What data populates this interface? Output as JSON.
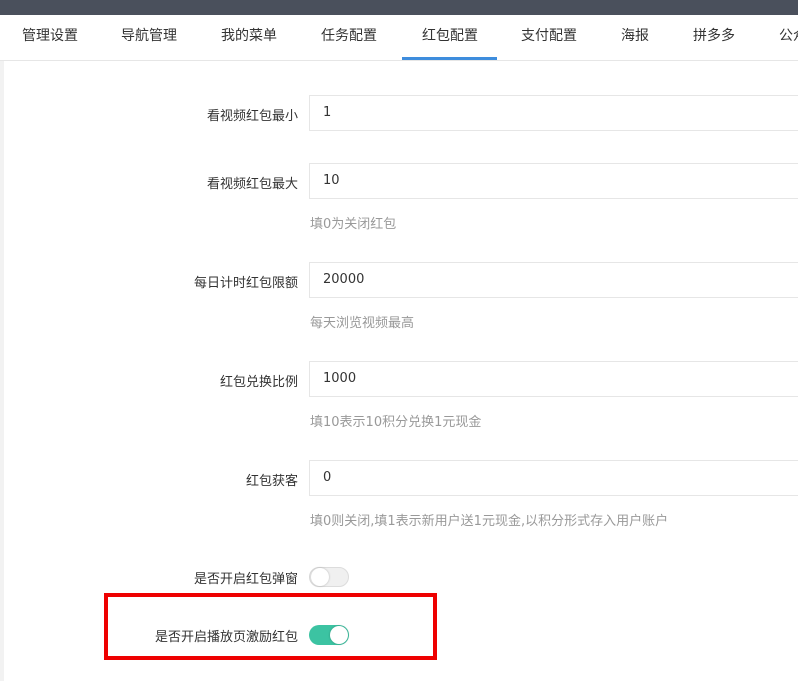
{
  "tabs": [
    {
      "label": "管理设置"
    },
    {
      "label": "导航管理"
    },
    {
      "label": "我的菜单"
    },
    {
      "label": "任务配置"
    },
    {
      "label": "红包配置",
      "active": true
    },
    {
      "label": "支付配置"
    },
    {
      "label": "海报"
    },
    {
      "label": "拼多多"
    },
    {
      "label": "公众"
    }
  ],
  "form": {
    "video_min": {
      "label": "看视频红包最小",
      "value": "1"
    },
    "video_max": {
      "label": "看视频红包最大",
      "value": "10",
      "hint": "填0为关闭红包"
    },
    "daily_limit": {
      "label": "每日计时红包限额",
      "value": "20000",
      "hint": "每天浏览视频最高"
    },
    "exchange_ratio": {
      "label": "红包兑换比例",
      "value": "1000",
      "hint": "填10表示10积分兑换1元现金"
    },
    "redpack_gain": {
      "label": "红包获客",
      "value": "0",
      "hint": "填0则关闭,填1表示新用户送1元现金,以积分形式存入用户账户"
    },
    "popup_switch": {
      "label": "是否开启红包弹窗",
      "on": false
    },
    "play_page_switch": {
      "label": "是否开启播放页激励红包",
      "on": true
    }
  },
  "colors": {
    "accent": "#3e8ddd",
    "switch_on": "#3cc3a2",
    "highlight": "#ee0000",
    "topbar": "#4a505c"
  }
}
